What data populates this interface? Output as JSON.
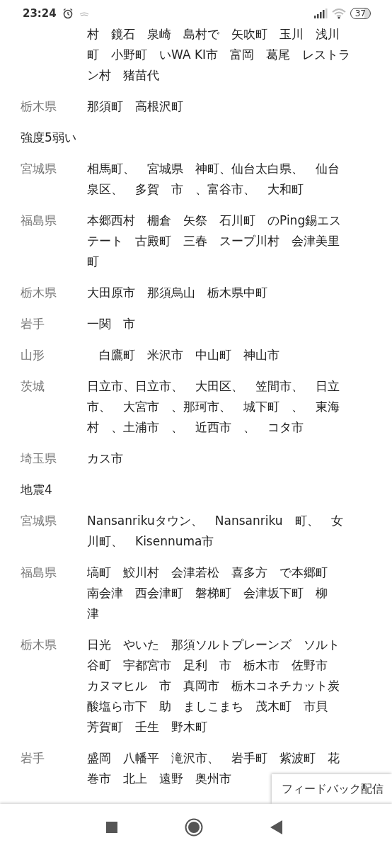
{
  "status_bar": {
    "time": "23:24",
    "battery": "37"
  },
  "rows": [
    {
      "kind": "area",
      "lines": [
        "村　鏡石　泉崎　島村で　矢吹町　玉川　浅川",
        "町　小野町　いWA KI市　富岡　葛尾　レストラ",
        "ン村　猪苗代"
      ]
    },
    {
      "kind": "area",
      "region": "栃木県",
      "lines": [
        "那須町　高根沢町"
      ]
    },
    {
      "kind": "heading",
      "text": "強度5弱い"
    },
    {
      "kind": "area",
      "region": "宮城県",
      "lines": [
        "相馬町、　宮城県　神町、仙台太白県、　仙台",
        "泉区、　多賀　市　、富谷市、　大和町"
      ]
    },
    {
      "kind": "area",
      "region": "福島県",
      "lines": [
        "本郷西村　棚倉　矢祭　石川町　のPing錫エス",
        "テート　古殿町　三春　スープ川村　会津美里",
        "町"
      ]
    },
    {
      "kind": "area",
      "region": "栃木県",
      "lines": [
        "大田原市　那須烏山　栃木県中町"
      ]
    },
    {
      "kind": "area",
      "region": "岩手",
      "lines": [
        "一関　市"
      ]
    },
    {
      "kind": "area",
      "region": "山形",
      "lines": [
        "　白鷹町　米沢市　中山町　神山市"
      ]
    },
    {
      "kind": "area",
      "region": "茨城",
      "lines": [
        "日立市、日立市、　大田区、　笠間市、　日立",
        "市、　大宮市　、那珂市、　城下町　、　東海",
        "村　、土浦市　、　近西市　、　コタ市"
      ]
    },
    {
      "kind": "area",
      "region": "埼玉県",
      "lines": [
        "カス市"
      ]
    },
    {
      "kind": "heading",
      "text": "地震4"
    },
    {
      "kind": "area",
      "region": "宮城県",
      "lines": [
        "Nansanrikuタウン、　Nansanriku　町、　女",
        "川町、　Kisennuma市"
      ]
    },
    {
      "kind": "area",
      "region": "福島県",
      "lines": [
        "塙町　鮫川村　会津若松　喜多方　で本郷町",
        "南会津　西会津町　磐梯町　会津坂下町　柳",
        "津"
      ]
    },
    {
      "kind": "area",
      "region": "栃木県",
      "lines": [
        "日光　やいた　那須ソルトプレーンズ　ソルト",
        "谷町　宇都宮市　足利　市　栃木市　佐野市",
        "カヌマヒル　市　真岡市　栃木コネチカット炭",
        "酸塩ら市下　助　ましこまち　茂木町　市貝",
        "芳賀町　壬生　野木町"
      ]
    },
    {
      "kind": "area",
      "region": "岩手",
      "lines": [
        "盛岡　八幡平　滝沢市、　岩手町　紫波町　花",
        "巻市　北上　遠野　奥州市"
      ]
    }
  ],
  "feedback_button": {
    "label": "フィードバック配信"
  }
}
